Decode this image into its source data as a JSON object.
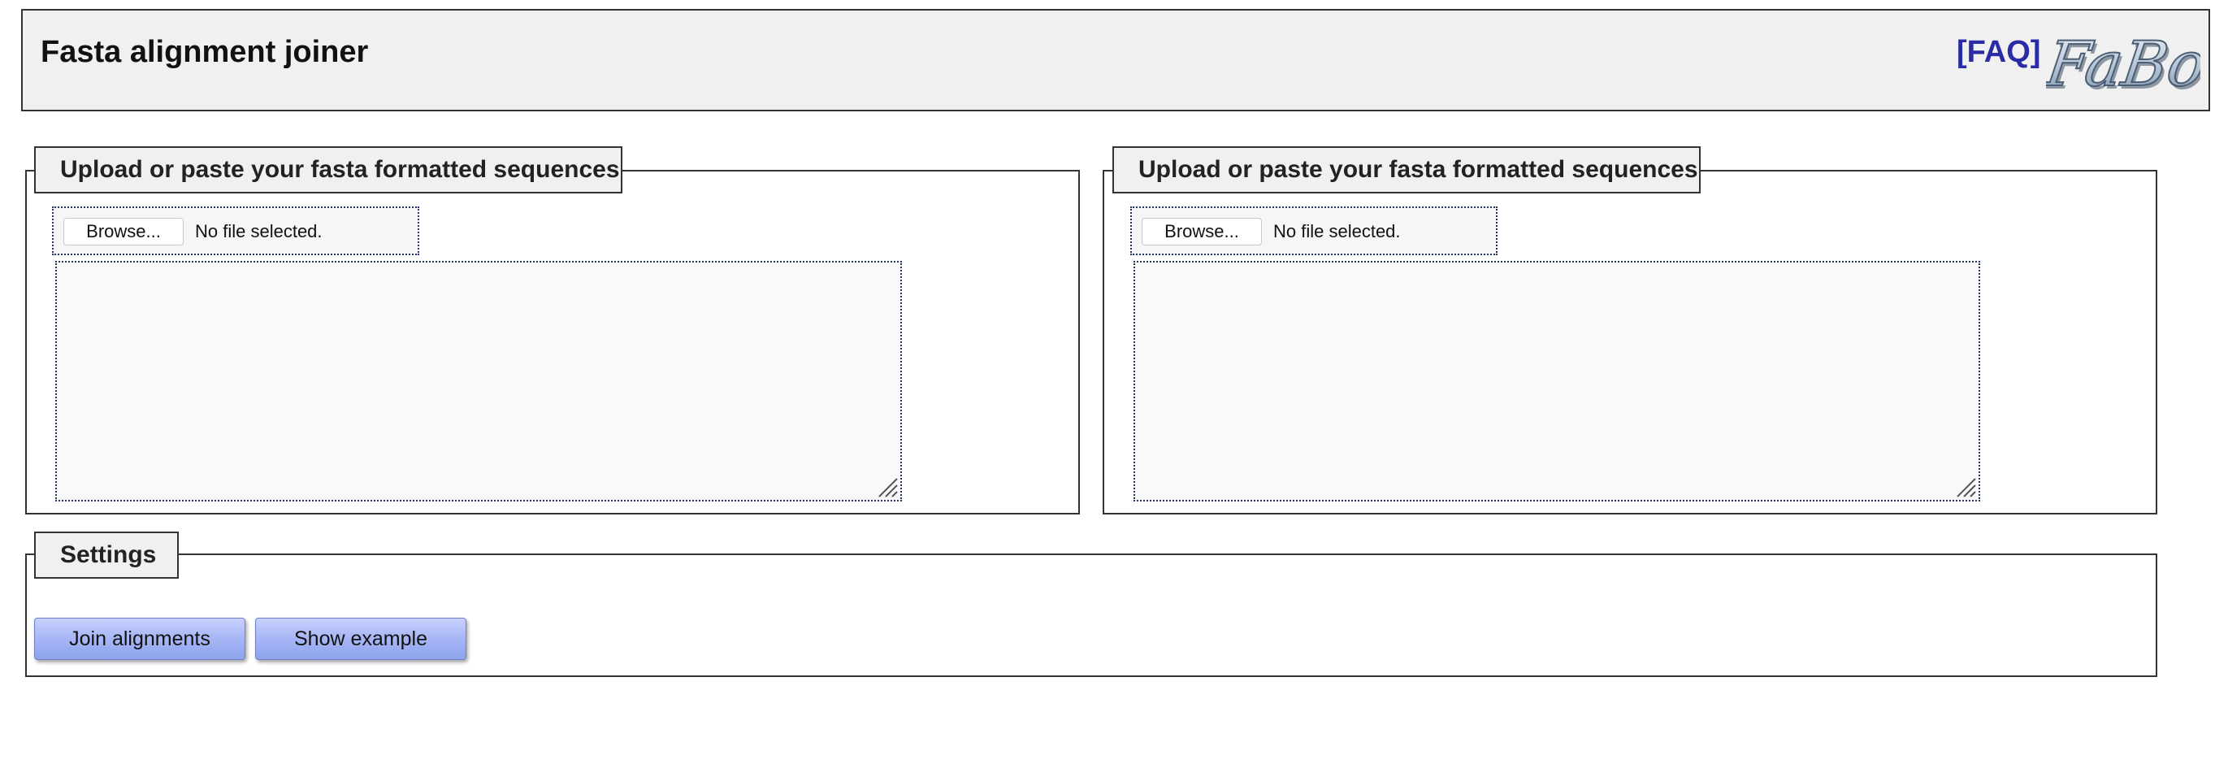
{
  "header": {
    "title": "Fasta alignment joiner",
    "faq_link": "[FAQ]",
    "logo_text": "FaBox"
  },
  "upload_panels": [
    {
      "legend": "Upload or paste your fasta formatted sequences",
      "browse_label": "Browse...",
      "file_status": "No file selected.",
      "textarea_value": ""
    },
    {
      "legend": "Upload or paste your fasta formatted sequences",
      "browse_label": "Browse...",
      "file_status": "No file selected.",
      "textarea_value": ""
    }
  ],
  "settings": {
    "legend": "Settings",
    "join_button": "Join alignments",
    "example_button": "Show example"
  },
  "colors": {
    "header_bg": "#f0f0f0",
    "faq_link": "#2b2ba6",
    "button_blue": "#a9b8f5"
  }
}
